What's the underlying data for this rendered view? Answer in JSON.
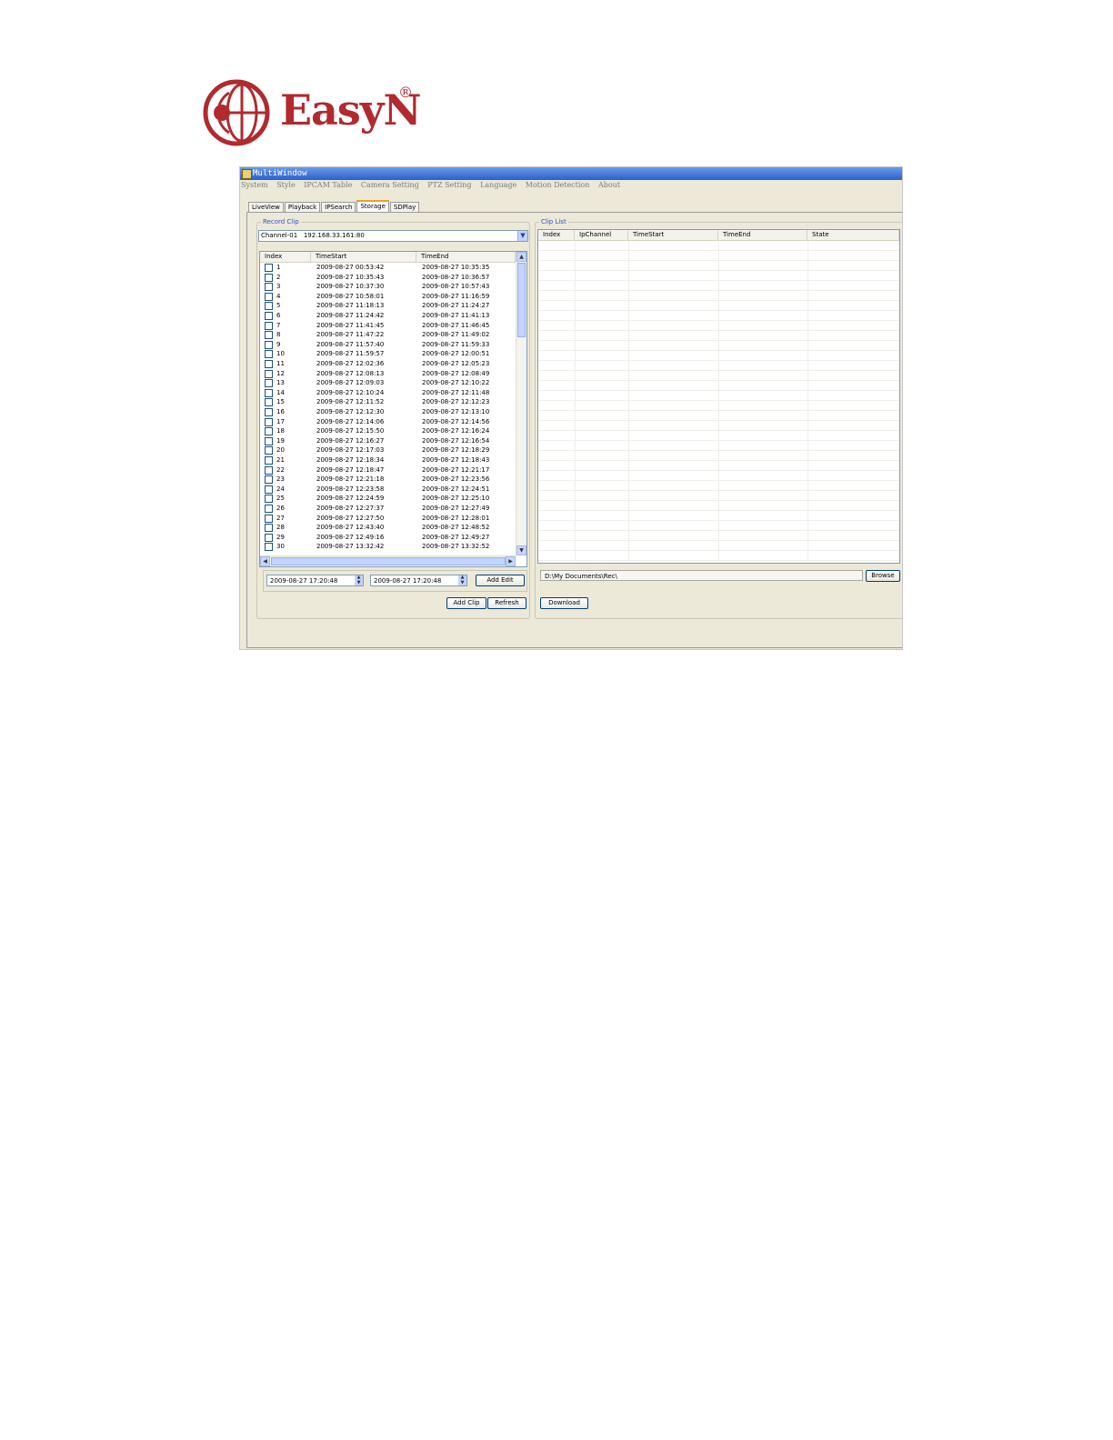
{
  "logo": {
    "brand": "EasyN",
    "registered": "®",
    "globe_icon": "globe-icon"
  },
  "window": {
    "title": "MultiWindow",
    "menu": [
      "System",
      "Style",
      "IPCAM Table",
      "Camera Setting",
      "PTZ Setting",
      "Language",
      "Motion Detection",
      "About"
    ],
    "tabs": [
      "LiveView",
      "Playback",
      "IPSearch",
      "Storage",
      "SDPlay"
    ],
    "active_tab": "Storage"
  },
  "record_clip": {
    "legend": "Record Clip",
    "channel": "Channel-01   192.168.33.161:80",
    "columns": [
      "Index",
      "TimeStart",
      "TimeEnd"
    ],
    "rows": [
      [
        "1",
        "2009-08-27 00:53:42",
        "2009-08-27 10:35:35"
      ],
      [
        "2",
        "2009-08-27 10:35:43",
        "2009-08-27 10:36:57"
      ],
      [
        "3",
        "2009-08-27 10:37:30",
        "2009-08-27 10:57:43"
      ],
      [
        "4",
        "2009-08-27 10:58:01",
        "2009-08-27 11:16:59"
      ],
      [
        "5",
        "2009-08-27 11:18:13",
        "2009-08-27 11:24:27"
      ],
      [
        "6",
        "2009-08-27 11:24:42",
        "2009-08-27 11:41:13"
      ],
      [
        "7",
        "2009-08-27 11:41:45",
        "2009-08-27 11:46:45"
      ],
      [
        "8",
        "2009-08-27 11:47:22",
        "2009-08-27 11:49:02"
      ],
      [
        "9",
        "2009-08-27 11:57:40",
        "2009-08-27 11:59:33"
      ],
      [
        "10",
        "2009-08-27 11:59:57",
        "2009-08-27 12:00:51"
      ],
      [
        "11",
        "2009-08-27 12:02:36",
        "2009-08-27 12:05:23"
      ],
      [
        "12",
        "2009-08-27 12:08:13",
        "2009-08-27 12:08:49"
      ],
      [
        "13",
        "2009-08-27 12:09:03",
        "2009-08-27 12:10:22"
      ],
      [
        "14",
        "2009-08-27 12:10:24",
        "2009-08-27 12:11:48"
      ],
      [
        "15",
        "2009-08-27 12:11:52",
        "2009-08-27 12:12:23"
      ],
      [
        "16",
        "2009-08-27 12:12:30",
        "2009-08-27 12:13:10"
      ],
      [
        "17",
        "2009-08-27 12:14:06",
        "2009-08-27 12:14:56"
      ],
      [
        "18",
        "2009-08-27 12:15:50",
        "2009-08-27 12:16:24"
      ],
      [
        "19",
        "2009-08-27 12:16:27",
        "2009-08-27 12:16:54"
      ],
      [
        "20",
        "2009-08-27 12:17:03",
        "2009-08-27 12:18:29"
      ],
      [
        "21",
        "2009-08-27 12:18:34",
        "2009-08-27 12:18:43"
      ],
      [
        "22",
        "2009-08-27 12:18:47",
        "2009-08-27 12:21:17"
      ],
      [
        "23",
        "2009-08-27 12:21:18",
        "2009-08-27 12:23:56"
      ],
      [
        "24",
        "2009-08-27 12:23:58",
        "2009-08-27 12:24:51"
      ],
      [
        "25",
        "2009-08-27 12:24:59",
        "2009-08-27 12:25:10"
      ],
      [
        "26",
        "2009-08-27 12:27:37",
        "2009-08-27 12:27:49"
      ],
      [
        "27",
        "2009-08-27 12:27:50",
        "2009-08-27 12:28:01"
      ],
      [
        "28",
        "2009-08-27 12:43:40",
        "2009-08-27 12:48:52"
      ],
      [
        "29",
        "2009-08-27 12:49:16",
        "2009-08-27 12:49:27"
      ],
      [
        "30",
        "2009-08-27 13:32:42",
        "2009-08-27 13:32:52"
      ]
    ],
    "start_time": "2009-08-27 17:20:48",
    "end_time": "2009-08-27 17:20:48",
    "add_edit_label": "Add Edit",
    "add_clip_label": "Add Clip",
    "refresh_label": "Refresh"
  },
  "clip_list": {
    "legend": "Clip List",
    "columns": [
      "Index",
      "IpChannel",
      "TimeStart",
      "TimeEnd",
      "State"
    ],
    "path": "D:\\My Documents\\Rec\\",
    "browse_label": "Browse",
    "download_label": "Download"
  },
  "colors": {
    "brand": "#b02a2e",
    "titlebar": "#2a5fd0",
    "legend": "#2a50c8"
  }
}
